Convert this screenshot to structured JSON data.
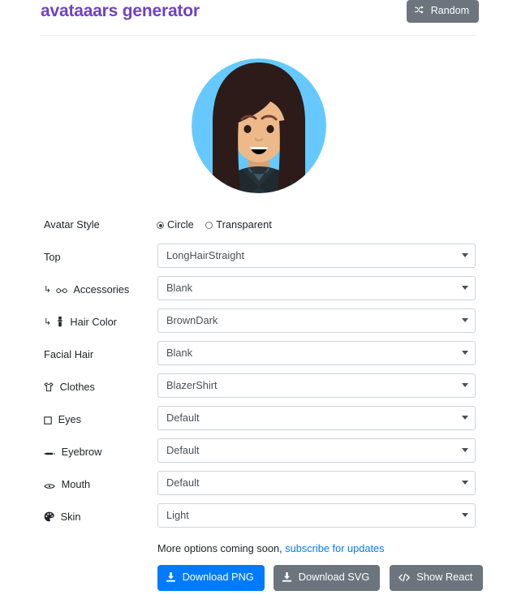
{
  "header": {
    "title": "avataaars generator",
    "random_button": {
      "label": "Random",
      "icon": "shuffle-icon",
      "bg": "#6c757d"
    },
    "title_color": "#6f42c1"
  },
  "avatar": {
    "alt": "avatar-preview",
    "style": "Circle",
    "background_color": "#65c9ff",
    "skin_color": "#edb98a",
    "hair_color": "#2c1b18",
    "clothes_color": "#263238",
    "top": "LongHairStraight",
    "clothes": "BlazerShirt",
    "mouth": "Default",
    "eyes": "Default"
  },
  "form": {
    "avatar_style": {
      "label": "Avatar Style",
      "options": [
        "Circle",
        "Transparent"
      ],
      "selected": "Circle"
    },
    "fields": [
      {
        "id": "top",
        "label": "Top",
        "icon": null,
        "sub": false,
        "value": "LongHairStraight"
      },
      {
        "id": "accessories",
        "label": "Accessories",
        "icon": "glasses-icon",
        "sub": true,
        "value": "Blank"
      },
      {
        "id": "hair-color",
        "label": "Hair Color",
        "icon": "paint-brush-icon",
        "sub": true,
        "value": "BrownDark"
      },
      {
        "id": "facial-hair",
        "label": "Facial Hair",
        "icon": null,
        "sub": false,
        "value": "Blank"
      },
      {
        "id": "clothes",
        "label": "Clothes",
        "icon": "tshirt-icon",
        "sub": false,
        "value": "BlazerShirt"
      },
      {
        "id": "eyes",
        "label": "Eyes",
        "icon": "eye-square-icon",
        "sub": false,
        "value": "Default"
      },
      {
        "id": "eyebrow",
        "label": "Eyebrow",
        "icon": "eyebrow-icon",
        "sub": false,
        "value": "Default"
      },
      {
        "id": "mouth",
        "label": "Mouth",
        "icon": "mouth-icon",
        "sub": false,
        "value": "Default"
      },
      {
        "id": "skin",
        "label": "Skin",
        "icon": "palette-icon",
        "sub": false,
        "value": "Light"
      }
    ]
  },
  "footer": {
    "more_options_text": "More options coming soon,",
    "subscribe_link": "subscribe for updates",
    "buttons": [
      {
        "id": "download-png",
        "label": "Download PNG",
        "icon": "download-icon",
        "style": "primary",
        "color": "#007bff"
      },
      {
        "id": "download-svg",
        "label": "Download SVG",
        "icon": "download-icon",
        "style": "secondary",
        "color": "#6c757d"
      },
      {
        "id": "show-react",
        "label": "Show React",
        "icon": "code-icon",
        "style": "secondary",
        "color": "#6c757d"
      }
    ]
  }
}
